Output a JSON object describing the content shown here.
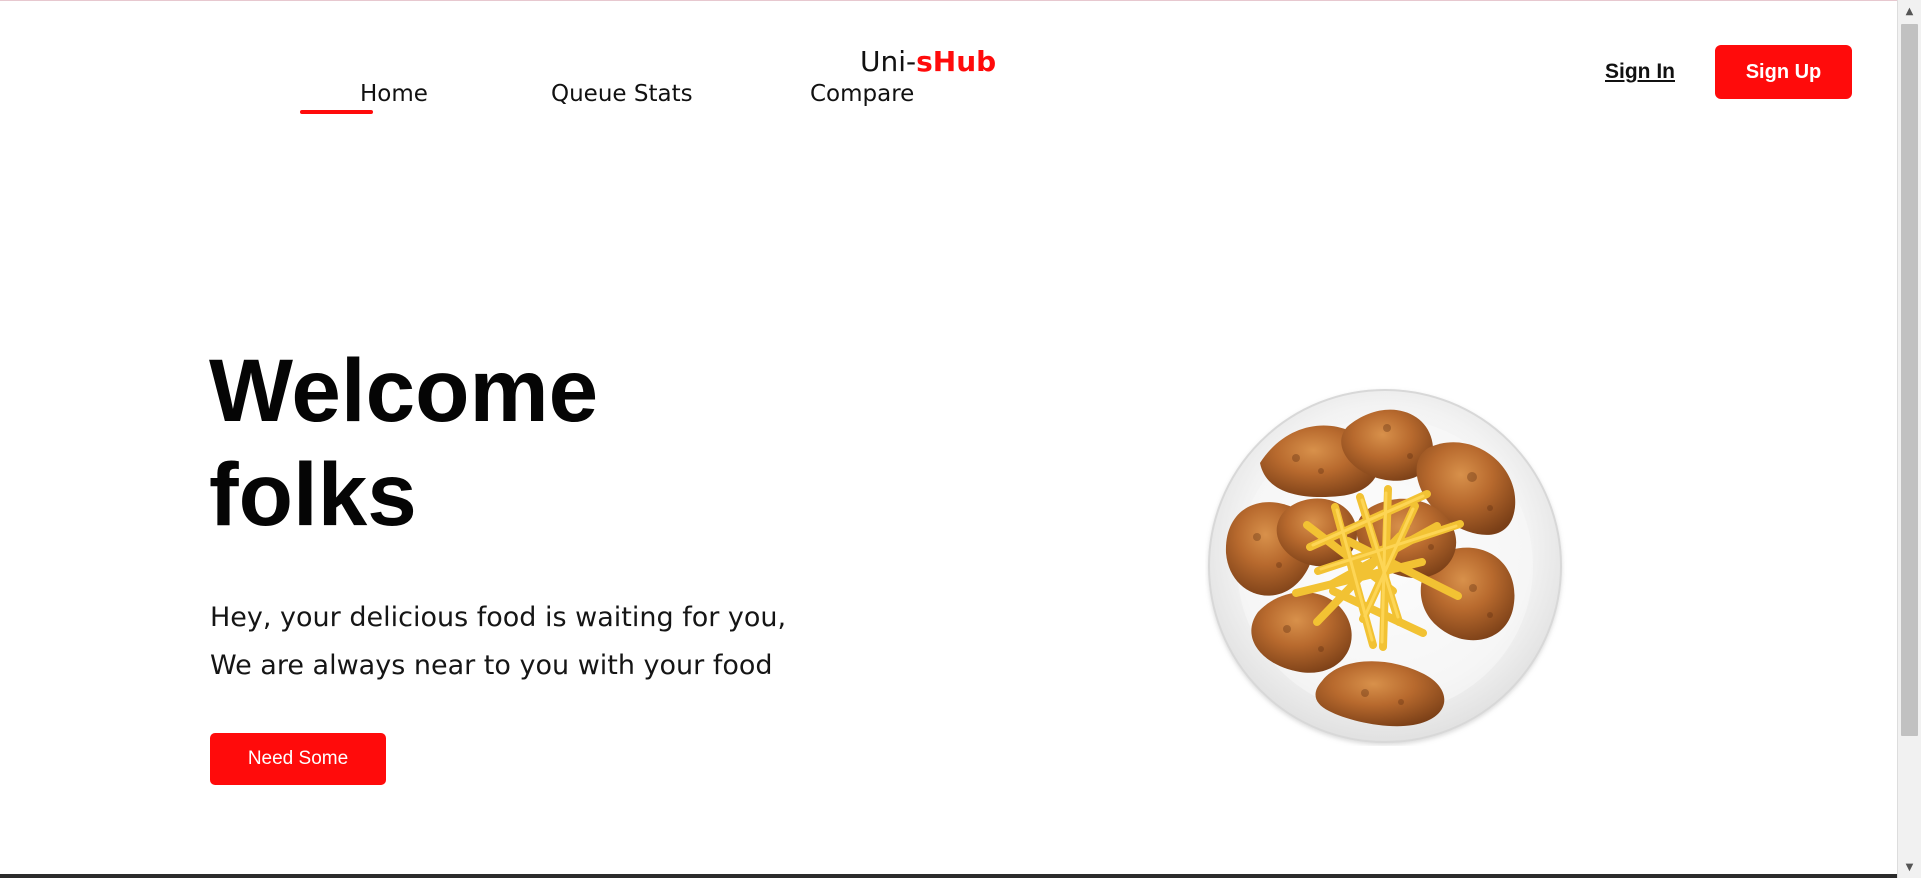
{
  "header": {
    "nav": {
      "home": "Home",
      "queue_stats": "Queue Stats",
      "compare": "Compare"
    },
    "logo": {
      "prefix": "Uni-",
      "suffix": "sHub"
    },
    "auth": {
      "sign_in": "Sign In",
      "sign_up": "Sign Up"
    }
  },
  "hero": {
    "title_line_1": "Welcome",
    "title_line_2": "folks",
    "subtitle_line_1": "Hey, your delicious food is waiting for you,",
    "subtitle_line_2": "We are always near to you with your food",
    "cta": "Need Some"
  },
  "scrollbar": {
    "up_icon": "triangle-up-icon",
    "down_icon": "triangle-down-icon"
  },
  "colors": {
    "accent": "#ff0b0b",
    "text": "#111111",
    "background": "#ffffff"
  }
}
